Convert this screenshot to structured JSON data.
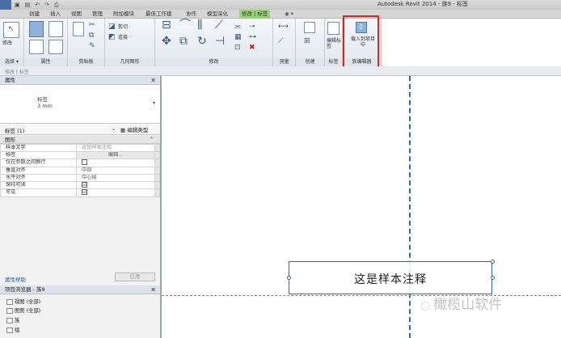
{
  "titlebar": {
    "title": "Autodesk Revit 2014 -    族9 - 标签"
  },
  "tabs": [
    {
      "label": "创建"
    },
    {
      "label": "插入"
    },
    {
      "label": "视图"
    },
    {
      "label": "管理"
    },
    {
      "label": "附加模块"
    },
    {
      "label": "最佳工作建"
    },
    {
      "label": "协作"
    },
    {
      "label": "模型深化"
    },
    {
      "label": "修改 | 标签"
    }
  ],
  "ribbon": {
    "properties_panel": {
      "label": "属性",
      "btn_modify": "修改",
      "btn_properties": "属性"
    },
    "select_panel": {
      "label": "选择 ▾"
    },
    "clipboard_panel": {
      "label": "剪贴板"
    },
    "geometry_panel": {
      "label": "几何图形",
      "cut": "剪切 ·",
      "join": "连接 ·"
    },
    "modify_panel": {
      "label": "修改"
    },
    "measure_panel": {
      "label": "测量"
    },
    "create_panel": {
      "label": "创建"
    },
    "label_panel": {
      "label": "标签",
      "edit_label": "编辑标签"
    },
    "family_editor_panel": {
      "label": "族编辑器",
      "load_into_project": "载入到项目中"
    }
  },
  "subbar": {
    "text": "修改 | 标签"
  },
  "properties": {
    "header": "属性",
    "type_name": "标签",
    "type_size": "3 mm",
    "instance_selector": "标签 (1)",
    "edit_type": "编辑类型",
    "group": "图形",
    "rows": [
      {
        "name": "样本文字",
        "value": "这是样本注释",
        "kind": "gray"
      },
      {
        "name": "标签",
        "value": "编辑...",
        "kind": "button"
      },
      {
        "name": "仅在参数之间换行",
        "value": "",
        "kind": "check"
      },
      {
        "name": "垂直对齐",
        "value": "中部",
        "kind": "text"
      },
      {
        "name": "水平对齐",
        "value": "中心线",
        "kind": "text"
      },
      {
        "name": "保持可读",
        "value": "☑",
        "kind": "checked"
      },
      {
        "name": "可见",
        "value": "☑",
        "kind": "checked"
      }
    ],
    "help_link": "属性帮助",
    "apply_button": "应用"
  },
  "project_browser": {
    "header": "项目浏览器 - 族9",
    "items": [
      {
        "label": "视图 (全部)"
      },
      {
        "label": "图例 (全部)"
      },
      {
        "label": "族"
      },
      {
        "label": "组"
      }
    ]
  },
  "canvas": {
    "note_text": "这是样本注释",
    "watermark": "橄榄山软件"
  },
  "colors": {
    "accent": "#2e6da4",
    "highlight": "#e2231a",
    "context_tab": "#9ad07a"
  }
}
